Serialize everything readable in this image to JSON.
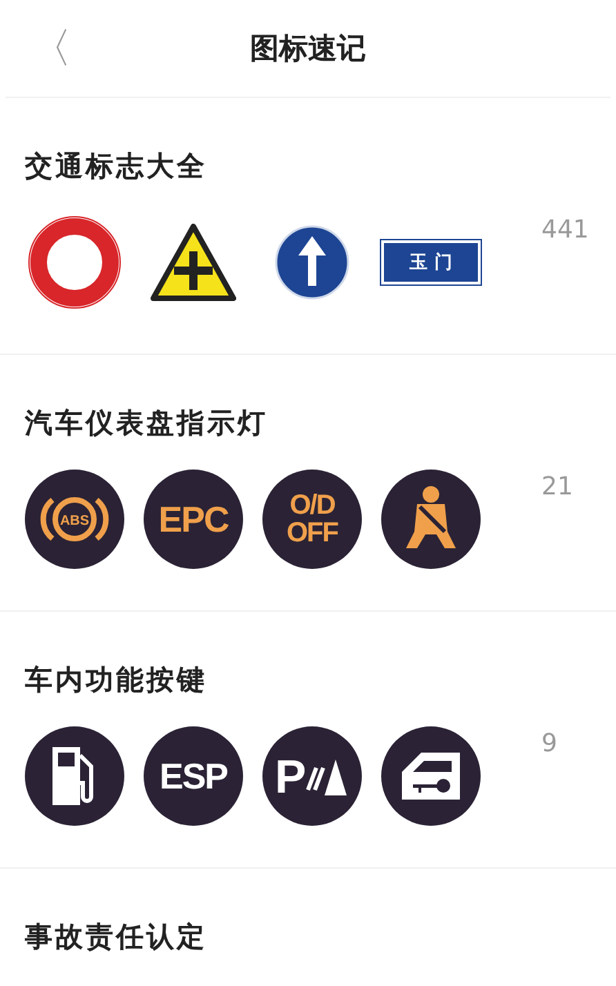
{
  "header": {
    "back": "〈",
    "title": "图标速记"
  },
  "sections": [
    {
      "title": "交通标志大全",
      "count": "441",
      "icons": [
        {
          "kind": "prohibition"
        },
        {
          "kind": "warning-cross"
        },
        {
          "kind": "direction-up"
        },
        {
          "kind": "place-name",
          "label": "玉 门"
        }
      ]
    },
    {
      "title": "汽车仪表盘指示灯",
      "count": "21",
      "icons": [
        {
          "kind": "abs",
          "label": "ABS"
        },
        {
          "kind": "text",
          "label": "EPC"
        },
        {
          "kind": "two-line",
          "lines": [
            "O/D",
            "OFF"
          ]
        },
        {
          "kind": "seatbelt"
        }
      ]
    },
    {
      "title": "车内功能按键",
      "count": "9",
      "icons": [
        {
          "kind": "fuel"
        },
        {
          "kind": "text",
          "label": "ESP"
        },
        {
          "kind": "parking",
          "label": "P"
        },
        {
          "kind": "door-key"
        }
      ]
    },
    {
      "title": "事故责任认定"
    }
  ]
}
